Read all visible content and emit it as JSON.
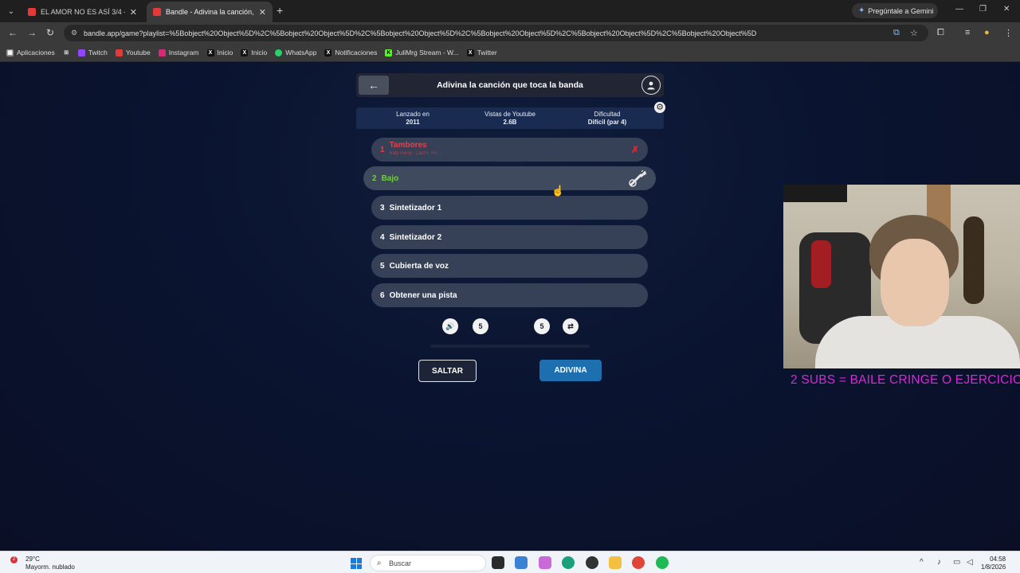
{
  "browser": {
    "tabs": [
      {
        "title": "EL AMOR NO ES ASÍ 3/4 - YouT",
        "favicon_color": "#e53935"
      },
      {
        "title": "Bandle - Adivina la canción, un",
        "favicon_color": "#e53935"
      }
    ],
    "gemini_label": "Pregúntale a Gemini",
    "url": "bandle.app/game?playlist=%5Bobject%20Object%5D%2C%5Bobject%20Object%5D%2C%5Bobject%20Object%5D%2C%5Bobject%20Object%5D%2C%5Bobject%20Object%5D%2C%5Bobject%20Object%5D",
    "bookmarks": [
      {
        "label": "Aplicaciones",
        "icon": "apps-icon",
        "color": "#888888"
      },
      {
        "label": "Twitch",
        "icon": "twitch-icon",
        "color": "#9146ff"
      },
      {
        "label": "Youtube",
        "icon": "youtube-icon",
        "color": "#e53935"
      },
      {
        "label": "Instagram",
        "icon": "instagram-icon",
        "color": "#d62976"
      },
      {
        "label": "Inicio",
        "icon": "x-icon",
        "color": "#111111"
      },
      {
        "label": "Inicio",
        "icon": "x-icon",
        "color": "#111111"
      },
      {
        "label": "WhatsApp",
        "icon": "whatsapp-icon",
        "color": "#25d366"
      },
      {
        "label": "Notificaciones",
        "icon": "x-icon",
        "color": "#111111"
      },
      {
        "label": "JuliMrg Stream - W...",
        "icon": "kick-icon",
        "color": "#53fc18"
      },
      {
        "label": "Twitter",
        "icon": "x-icon",
        "color": "#111111"
      }
    ]
  },
  "game": {
    "title": "Adivina la canción que toca la banda",
    "stats": [
      {
        "label": "Lanzado en",
        "value": "2011"
      },
      {
        "label": "Vistas de Youtube",
        "value": "2.6B"
      },
      {
        "label": "Dificultad",
        "value": "Difícil (par 4)"
      }
    ],
    "options": [
      {
        "num": "1",
        "label": "Tambores",
        "sub": "Katy Perry - Last F. Fri...",
        "state": "wrong"
      },
      {
        "num": "2",
        "label": "Bajo",
        "state": "correct"
      },
      {
        "num": "3",
        "label": "Sintetizador 1",
        "state": "locked"
      },
      {
        "num": "4",
        "label": "Sintetizador 2",
        "state": "locked"
      },
      {
        "num": "5",
        "label": "Cubierta de voz",
        "state": "locked"
      },
      {
        "num": "6",
        "label": "Obtener una pista",
        "state": "locked"
      }
    ],
    "controls": {
      "rewind_label": "5",
      "forward_label": "5"
    },
    "progress": 0.0,
    "skip_label": "SALTAR",
    "guess_label": "ADIVINA"
  },
  "overlay": {
    "caption": "2 SUBS = BAILE CRINGE O EJERCICIO"
  },
  "taskbar": {
    "weather_temp": "29°C",
    "weather_desc": "Mayorm. nublado",
    "weather_badge": "2",
    "search_placeholder": "Buscar",
    "time": "04:58",
    "date": "1/8/2026"
  }
}
